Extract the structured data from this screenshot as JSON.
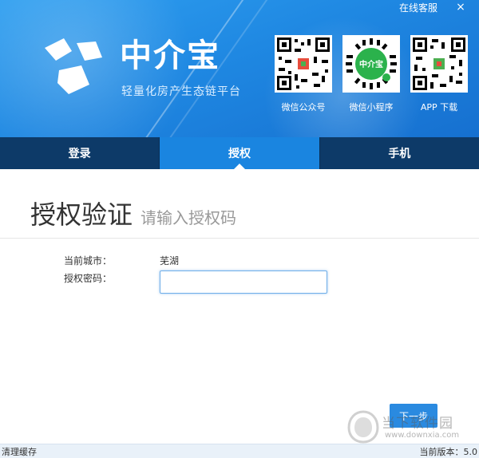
{
  "header": {
    "support_link": "在线客服",
    "close_icon": "×",
    "brand_name": "中介宝",
    "tagline": "轻量化房产生态链平台",
    "qr_codes": [
      {
        "caption": "微信公众号",
        "icon": "wechat-qr-code"
      },
      {
        "caption": "微信小程序",
        "icon": "mini-program-code"
      },
      {
        "caption": "APP 下载",
        "icon": "app-download-qr-code"
      }
    ],
    "colors": {
      "primary": "#1f88e2",
      "tab_bar": "#0d3a68",
      "tab_active": "#1a85e0"
    }
  },
  "tabs": [
    {
      "label": "登录",
      "active": false
    },
    {
      "label": "授权",
      "active": true
    },
    {
      "label": "手机",
      "active": false
    }
  ],
  "main": {
    "title": "授权验证",
    "subtitle": "请输入授权码",
    "city_label": "当前城市：",
    "city_value": "芜湖",
    "password_label": "授权密码：",
    "password_value": "",
    "next_button": "下一步"
  },
  "watermark": {
    "name": "当下软件园",
    "url": "www.downxia.com"
  },
  "statusbar": {
    "clear_cache": "清理缓存",
    "version": "当前版本：5.0"
  }
}
